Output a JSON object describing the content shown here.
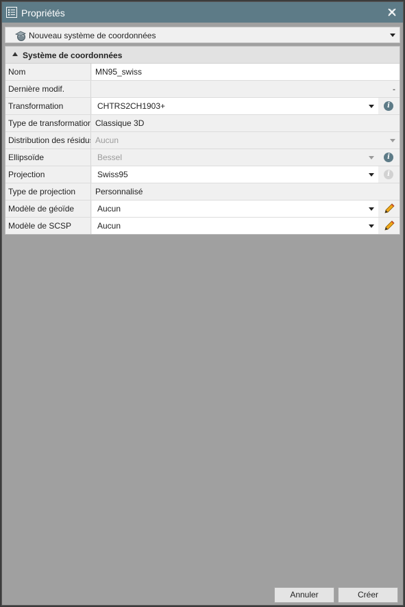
{
  "window": {
    "title": "Propriétés"
  },
  "selector": {
    "value": "Nouveau système de coordonnées"
  },
  "section": {
    "title": "Système de coordonnées"
  },
  "rows": [
    {
      "label": "Nom",
      "value": "MN95_swiss"
    },
    {
      "label": "Dernière modif.",
      "value": "-"
    },
    {
      "label": "Transformation",
      "value": "CHTRS2CH1903+"
    },
    {
      "label": "Type de transformation",
      "value": "Classique 3D"
    },
    {
      "label": "Distribution des résidus",
      "value": "Aucun"
    },
    {
      "label": "Ellipsoïde",
      "value": "Bessel"
    },
    {
      "label": "Projection",
      "value": "Swiss95"
    },
    {
      "label": "Type de projection",
      "value": "Personnalisé"
    },
    {
      "label": "Modèle de géoïde",
      "value": "Aucun"
    },
    {
      "label": "Modèle de SCSP",
      "value": "Aucun"
    }
  ],
  "icons": {
    "info": "i"
  },
  "buttons": {
    "cancel": "Annuler",
    "create": "Créer"
  },
  "colors": {
    "titlebar": "#5d7b87",
    "pencil": "#f0a818"
  }
}
